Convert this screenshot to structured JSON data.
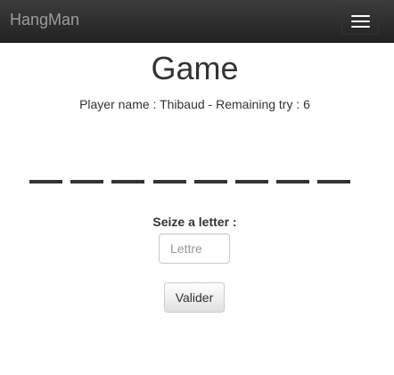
{
  "navbar": {
    "brand": "HangMan",
    "toggle_icon": "hamburger-menu-icon",
    "background": "#222222",
    "brand_color": "#9d9d9d"
  },
  "game": {
    "title": "Game",
    "player_label": "Player name",
    "player_name": "Thibaud",
    "separator": " - ",
    "remaining_label": "Remaining try",
    "remaining_try": 6,
    "status_line": "Player name : Thibaud - Remaining try : 6",
    "word_length": 8,
    "revealed_letters": [
      "",
      "",
      "",
      "",
      "",
      "",
      "",
      ""
    ]
  },
  "form": {
    "label": "Seize a letter :",
    "input_value": "",
    "input_placeholder": "Lettre",
    "submit_label": "Valider"
  }
}
